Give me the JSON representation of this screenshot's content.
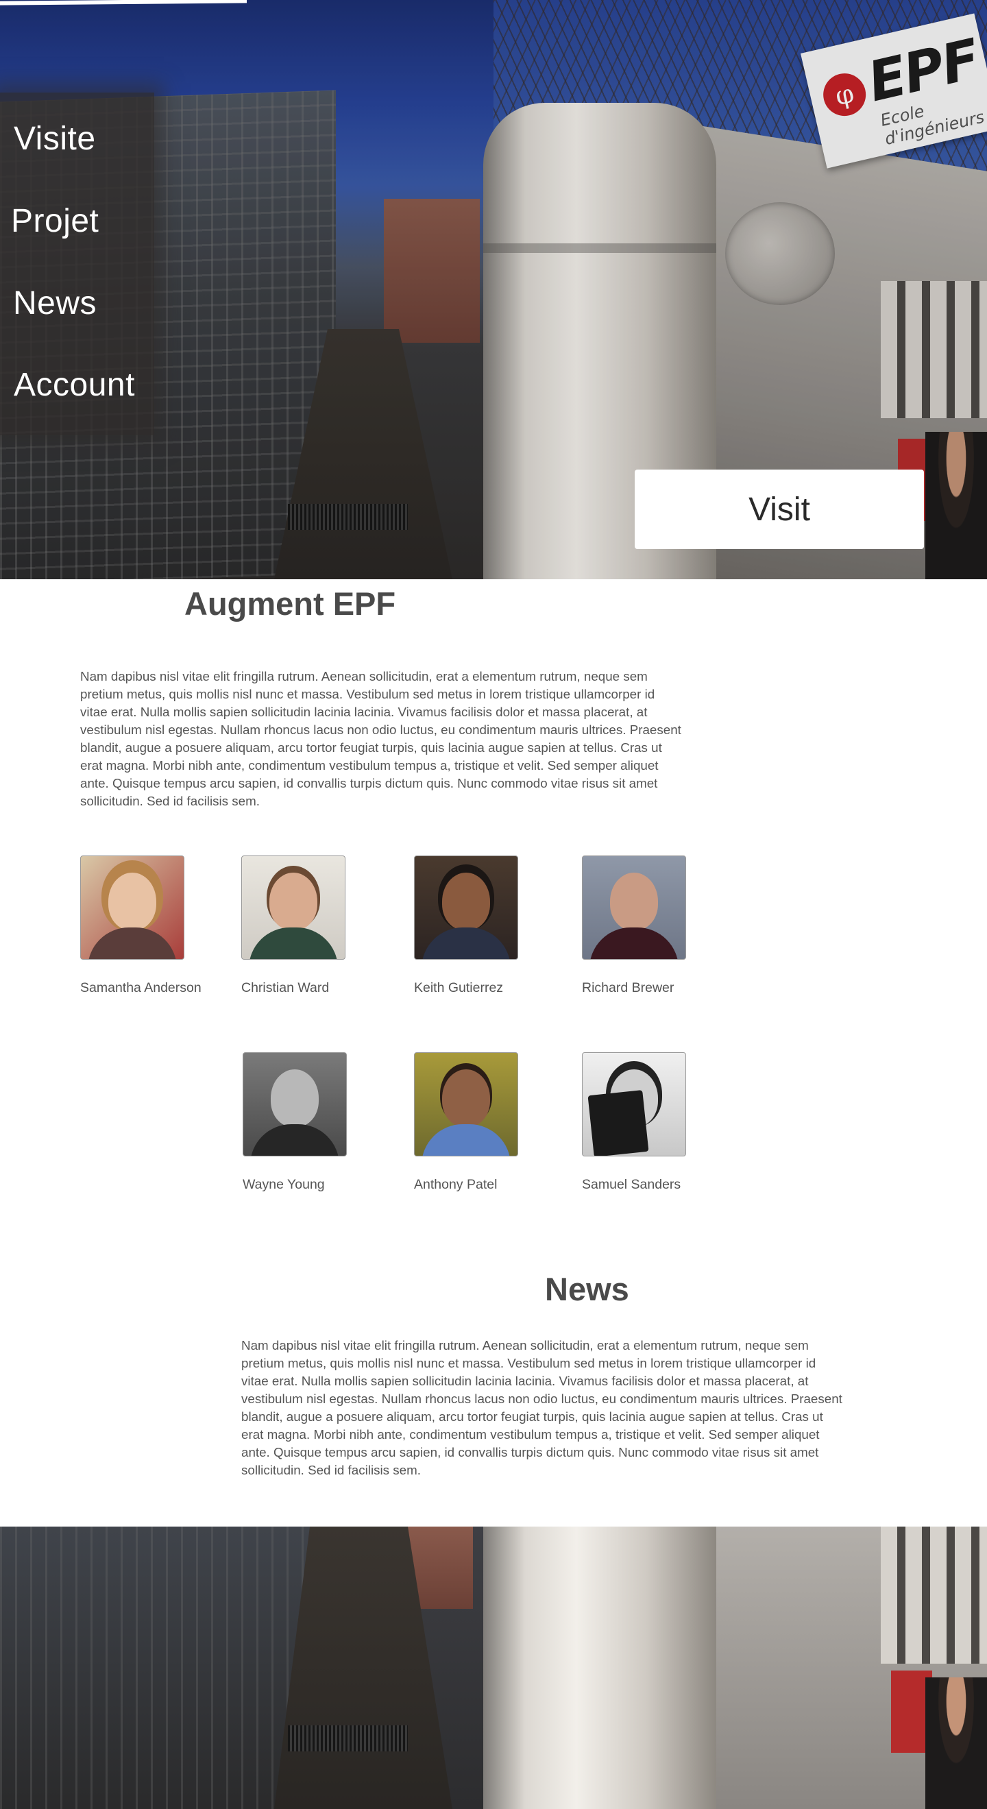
{
  "nav": {
    "items": [
      {
        "label": "Visite"
      },
      {
        "label": "Projet"
      },
      {
        "label": "News"
      },
      {
        "label": "Account"
      }
    ]
  },
  "hero": {
    "visit_button_label": "Visit",
    "sign": {
      "brand": "EPF",
      "subtitle": "Ecole d'ingénieurs",
      "logo_glyph": "φ"
    }
  },
  "about": {
    "title": "Augment EPF",
    "text": "Nam dapibus nisl vitae elit fringilla rutrum. Aenean sollicitudin, erat a elementum rutrum, neque sem pretium metus, quis mollis nisl nunc et massa. Vestibulum sed metus in lorem tristique ullamcorper id vitae erat. Nulla mollis sapien sollicitudin lacinia lacinia. Vivamus facilisis dolor et massa placerat, at vestibulum nisl egestas. Nullam rhoncus lacus non odio luctus, eu condimentum mauris ultrices. Praesent blandit, augue a posuere aliquam, arcu tortor feugiat turpis, quis lacinia augue sapien at tellus. Cras ut erat magna. Morbi nibh ante, condimentum vestibulum tempus a, tristique et velit. Sed semper aliquet ante. Quisque tempus arcu sapien, id convallis turpis dictum quis. Nunc commodo vitae risus sit amet sollicitudin. Sed id facilisis sem."
  },
  "team": [
    {
      "name": "Samantha Anderson"
    },
    {
      "name": "Christian Ward"
    },
    {
      "name": "Keith Gutierrez"
    },
    {
      "name": "Richard Brewer"
    },
    {
      "name": "Wayne Young"
    },
    {
      "name": "Anthony Patel"
    },
    {
      "name": "Samuel Sanders"
    }
  ],
  "news": {
    "title": "News",
    "text": "Nam dapibus nisl vitae elit fringilla rutrum. Aenean sollicitudin, erat a elementum rutrum, neque sem pretium metus, quis mollis nisl nunc et massa. Vestibulum sed metus in lorem tristique ullamcorper id vitae erat. Nulla mollis sapien sollicitudin lacinia lacinia. Vivamus facilisis dolor et massa placerat, at vestibulum nisl egestas. Nullam rhoncus lacus non odio luctus, eu condimentum mauris ultrices. Praesent blandit, augue a posuere aliquam, arcu tortor feugiat turpis, quis lacinia augue sapien at tellus. Cras ut erat magna. Morbi nibh ante, condimentum vestibulum tempus a, tristique et velit. Sed semper aliquet ante. Quisque tempus arcu sapien, id convallis turpis dictum quis. Nunc commodo vitae risus sit amet sollicitudin. Sed id facilisis sem."
  },
  "colors": {
    "heading": "#4a4a4a",
    "body_text": "#555555",
    "nav_overlay": "#302c2a",
    "brand_red": "#c62127"
  }
}
